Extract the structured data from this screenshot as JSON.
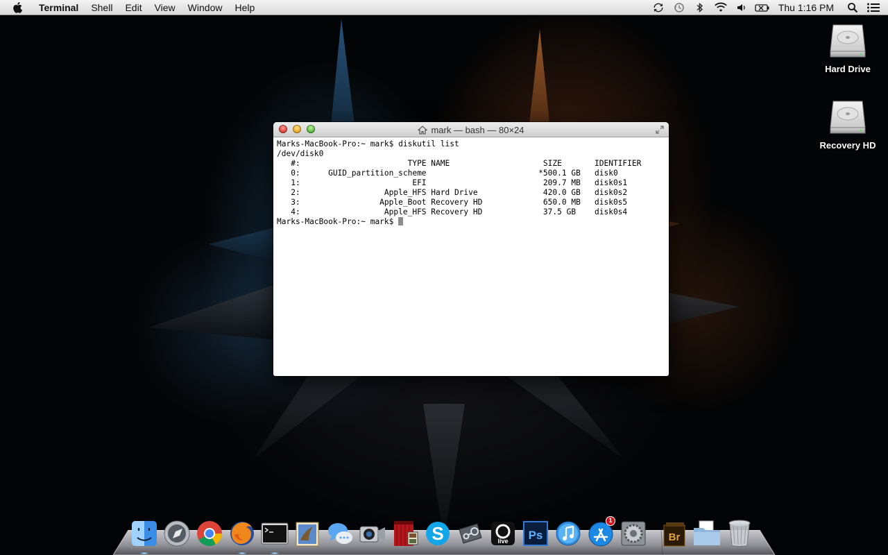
{
  "menubar": {
    "app_name": "Terminal",
    "items": [
      "Shell",
      "Edit",
      "View",
      "Window",
      "Help"
    ],
    "status_icons": [
      "sync-icon",
      "time-machine-icon",
      "bluetooth-icon",
      "wifi-icon",
      "volume-icon",
      "battery-icon"
    ],
    "clock": "Thu 1:16 PM"
  },
  "desktop": {
    "icons": [
      {
        "label": "Hard Drive",
        "icon": "hard-drive-icon"
      },
      {
        "label": "Recovery HD",
        "icon": "hard-drive-icon"
      }
    ]
  },
  "window": {
    "title": "mark — bash — 80×24",
    "lines": [
      "Marks-MacBook-Pro:~ mark$ diskutil list",
      "/dev/disk0",
      "   #:                       TYPE NAME                    SIZE       IDENTIFIER",
      "   0:      GUID_partition_scheme                        *500.1 GB   disk0",
      "   1:                        EFI                         209.7 MB   disk0s1",
      "   2:                  Apple_HFS Hard Drive              420.0 GB   disk0s2",
      "   3:                 Apple_Boot Recovery HD             650.0 MB   disk0s5",
      "   4:                  Apple_HFS Recovery HD             37.5 GB    disk0s4"
    ],
    "prompt": "Marks-MacBook-Pro:~ mark$ "
  },
  "dock": {
    "apps": [
      {
        "name": "finder-icon",
        "running": true
      },
      {
        "name": "launchpad-icon",
        "running": false
      },
      {
        "name": "chrome-icon",
        "running": false
      },
      {
        "name": "firefox-icon",
        "running": true
      },
      {
        "name": "terminal-icon",
        "running": true
      },
      {
        "name": "mail-icon",
        "running": false
      },
      {
        "name": "messages-icon",
        "running": false
      },
      {
        "name": "facetime-icon",
        "running": false
      },
      {
        "name": "photo-booth-icon",
        "running": false
      },
      {
        "name": "skype-icon",
        "running": false
      },
      {
        "name": "steam-icon",
        "running": false
      },
      {
        "name": "ableton-live-icon",
        "running": false
      },
      {
        "name": "photoshop-icon",
        "running": false
      },
      {
        "name": "itunes-icon",
        "running": false
      },
      {
        "name": "app-store-icon",
        "running": false,
        "badge": "1"
      },
      {
        "name": "system-preferences-icon",
        "running": false
      }
    ],
    "right": [
      {
        "name": "bridge-icon"
      },
      {
        "name": "documents-folder-icon"
      },
      {
        "name": "trash-icon"
      }
    ]
  }
}
